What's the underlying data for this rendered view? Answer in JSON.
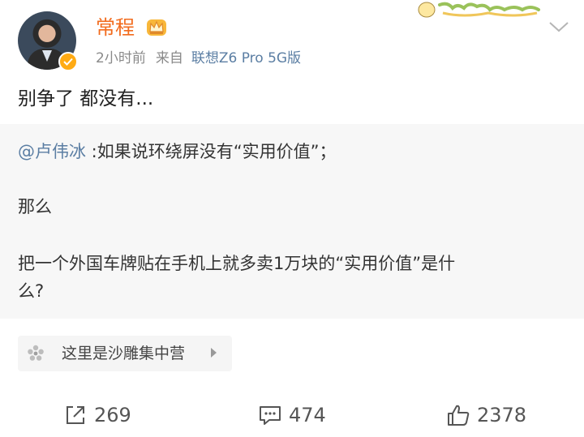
{
  "post": {
    "author": "常程",
    "time": "2小时前",
    "from_label": "来自",
    "device": "联想Z6 Pro 5G版",
    "text": "别争了 都没有..."
  },
  "repost": {
    "mention": "@卢伟冰",
    "line1_rest": " :如果说环绕屏没有“实用价值”；",
    "line2": "那么",
    "line3": "把一个外国车牌贴在手机上就多卖1万块的“实用价值”是什",
    "line4": "么?"
  },
  "group": {
    "label": "这里是沙雕集中营"
  },
  "actions": {
    "share_count": "269",
    "comment_count": "474",
    "like_count": "2378"
  },
  "icons": {
    "verified": "verified-badge-icon",
    "crown": "crown-icon",
    "chevron": "chevron-down-icon",
    "group": "flower-icon",
    "share": "share-icon",
    "comment": "comment-icon",
    "like": "thumbs-up-icon"
  },
  "colors": {
    "author": "#f26b1d",
    "link": "#5b7ea3",
    "verified": "#ffab14",
    "repost_bg": "#f7f7f7"
  }
}
